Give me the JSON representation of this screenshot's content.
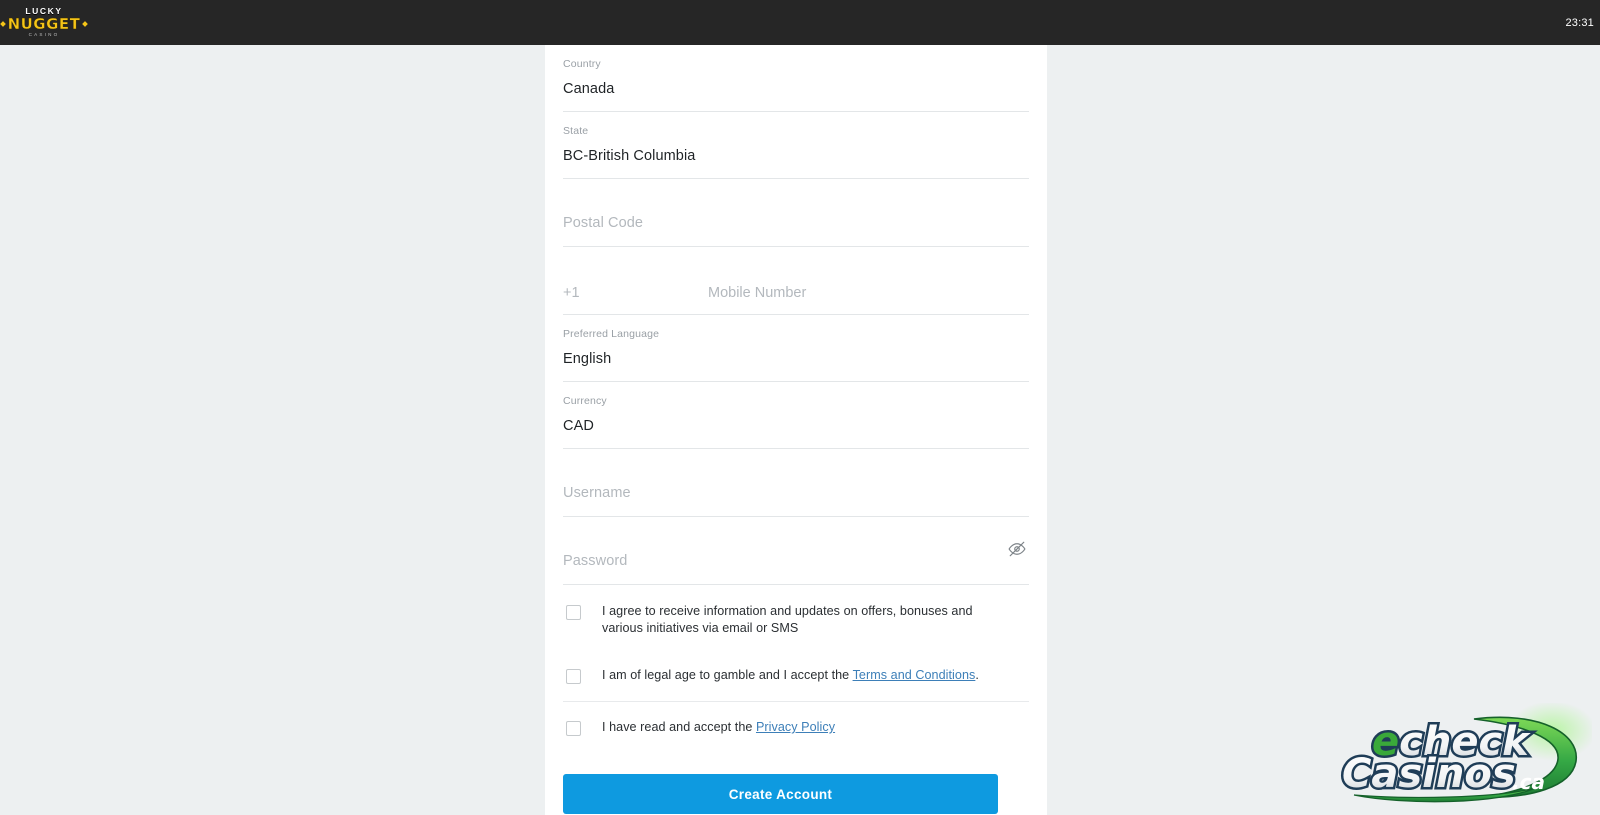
{
  "topbar": {
    "logo": {
      "line1": "LUCKY",
      "line2": "NUGGET",
      "line3": "CASINO",
      "icon": "lucky-nugget-logo"
    },
    "clock": "23:31"
  },
  "form": {
    "country": {
      "label": "Country",
      "value": "Canada"
    },
    "state": {
      "label": "State",
      "value": "BC-British Columbia"
    },
    "postal_code": {
      "placeholder": "Postal Code",
      "value": ""
    },
    "phone": {
      "prefix": "+1",
      "placeholder": "Mobile Number",
      "value": ""
    },
    "language": {
      "label": "Preferred Language",
      "value": "English"
    },
    "currency": {
      "label": "Currency",
      "value": "CAD"
    },
    "username": {
      "placeholder": "Username",
      "value": ""
    },
    "password": {
      "placeholder": "Password",
      "value": "",
      "toggle_icon": "eye-off-icon"
    },
    "checkboxes": [
      {
        "id": "marketing-consent",
        "text": "I agree to receive information and updates on offers, bonuses and various initiatives via email or SMS",
        "checked": false
      },
      {
        "id": "terms-consent",
        "text_before": "I am of legal age to gamble and I accept the ",
        "link": "Terms and Conditions",
        "text_after": ".",
        "checked": false
      },
      {
        "id": "privacy-consent",
        "text_before": "I have read and accept the ",
        "link": "Privacy Policy",
        "text_after": "",
        "checked": false
      }
    ],
    "submit_label": "Create Account"
  },
  "watermark": {
    "line1_pre": "e",
    "line1_post": "check",
    "line2": "Casinos",
    "tld": ".ca",
    "icon": "echeckcasinos-logo"
  },
  "colors": {
    "topbar_bg": "#262626",
    "page_bg": "#edf0f1",
    "panel_bg": "#ffffff",
    "accent_blue": "#0e9ae0",
    "link_blue": "#3d7fb8",
    "brand_gold": "#f5c518",
    "label_gray": "#9aa0a6",
    "placeholder_gray": "#b3b8bd",
    "value_dark": "#1f2326",
    "watermark_green": "#3aa93a",
    "watermark_navy": "#2e4a66"
  }
}
